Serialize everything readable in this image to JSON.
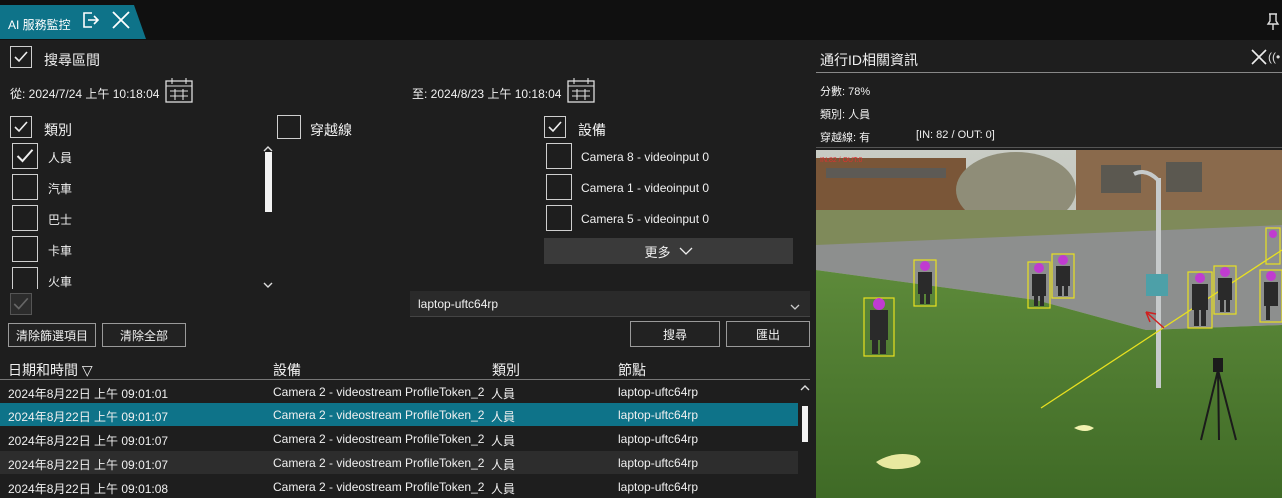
{
  "window": {
    "tab_title": "AI 服務監控",
    "icons": [
      "exit-icon",
      "close-icon",
      "pin-icon"
    ]
  },
  "search_range": {
    "label": "搜尋區間",
    "checked": true,
    "from_text": "從: 2024/7/24 上午 10:18:04",
    "to_text": "至: 2024/8/23 上午 10:18:04"
  },
  "filters": {
    "category": {
      "label": "類別",
      "checked": true,
      "items": [
        {
          "label": "人員",
          "checked": true
        },
        {
          "label": "汽車",
          "checked": false
        },
        {
          "label": "巴士",
          "checked": false
        },
        {
          "label": "卡車",
          "checked": false
        },
        {
          "label": "火車",
          "checked": false
        }
      ]
    },
    "crossline": {
      "label": "穿越線",
      "checked": false
    },
    "device": {
      "label": "設備",
      "checked": true,
      "items": [
        {
          "label": "Camera 8 - videoinput 0",
          "checked": false
        },
        {
          "label": "Camera 1 - videoinput 0",
          "checked": false
        },
        {
          "label": "Camera 5 - videoinput 0",
          "checked": false
        }
      ],
      "more_label": "更多"
    },
    "node_select": "laptop-uftc64rp"
  },
  "buttons": {
    "clear_selection": "清除篩選項目",
    "clear_all": "清除全部",
    "search": "搜尋",
    "export": "匯出"
  },
  "table": {
    "columns": [
      "日期和時間 ▽",
      "設備",
      "類別",
      "節點"
    ],
    "rows": [
      [
        "2024年8月22日 上午 09:01:01",
        "Camera 2 - videostream ProfileToken_2",
        "人員",
        "laptop-uftc64rp"
      ],
      [
        "2024年8月22日 上午 09:01:07",
        "Camera 2 - videostream ProfileToken_2",
        "人員",
        "laptop-uftc64rp"
      ],
      [
        "2024年8月22日 上午 09:01:07",
        "Camera 2 - videostream ProfileToken_2",
        "人員",
        "laptop-uftc64rp"
      ],
      [
        "2024年8月22日 上午 09:01:07",
        "Camera 2 - videostream ProfileToken_2",
        "人員",
        "laptop-uftc64rp"
      ],
      [
        "2024年8月22日 上午 09:01:08",
        "Camera 2 - videostream ProfileToken_2",
        "人員",
        "laptop-uftc64rp"
      ]
    ],
    "selected_row": 1
  },
  "detail_panel": {
    "title": "通行ID相關資訊",
    "extra": "((•",
    "score": "分數: 78%",
    "category": "類別: 人員",
    "crossline": "穿越線: 有",
    "in_out": "[IN: 82 / OUT: 0]",
    "overlay_text": "IN:82 / OUT:0"
  },
  "colors": {
    "accent": "#0e7389",
    "background": "#1e1e1e",
    "bbox": "#e8e020",
    "person_head": "#c03cd0"
  }
}
